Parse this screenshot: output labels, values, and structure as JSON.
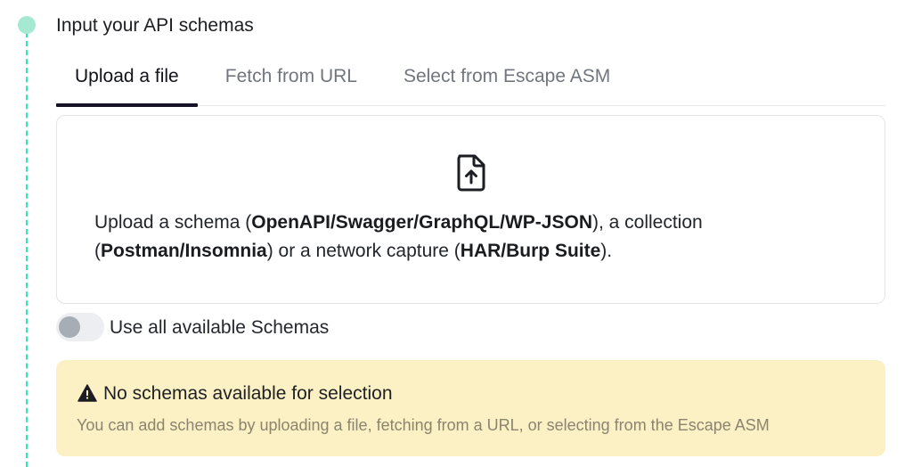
{
  "step": {
    "title": "Input your API schemas"
  },
  "tabs": [
    {
      "label": "Upload a file",
      "active": true
    },
    {
      "label": "Fetch from URL",
      "active": false
    },
    {
      "label": "Select from Escape ASM",
      "active": false
    }
  ],
  "dropzone": {
    "icon": "file-upload-icon",
    "text_parts": {
      "p1": "Upload a schema (",
      "b1": "OpenAPI/Swagger/GraphQL/WP-JSON",
      "p2": "), a collection",
      "p3": "(",
      "b2": "Postman/Insomnia",
      "p4": ") or a network capture (",
      "b3": "HAR/Burp Suite",
      "p5": ")."
    }
  },
  "toggle": {
    "label": "Use all available Schemas",
    "checked": false
  },
  "alert": {
    "icon": "warning-triangle-icon",
    "title": "No schemas available for selection",
    "description": "You can add schemas by uploading a file, fetching from a URL, or selecting from the Escape ASM"
  },
  "colors": {
    "timeline": "#2ee6b8",
    "timeline_dot": "#a6e9d2",
    "tab_indicator": "#141224",
    "alert_bg": "#fcf1c4"
  }
}
